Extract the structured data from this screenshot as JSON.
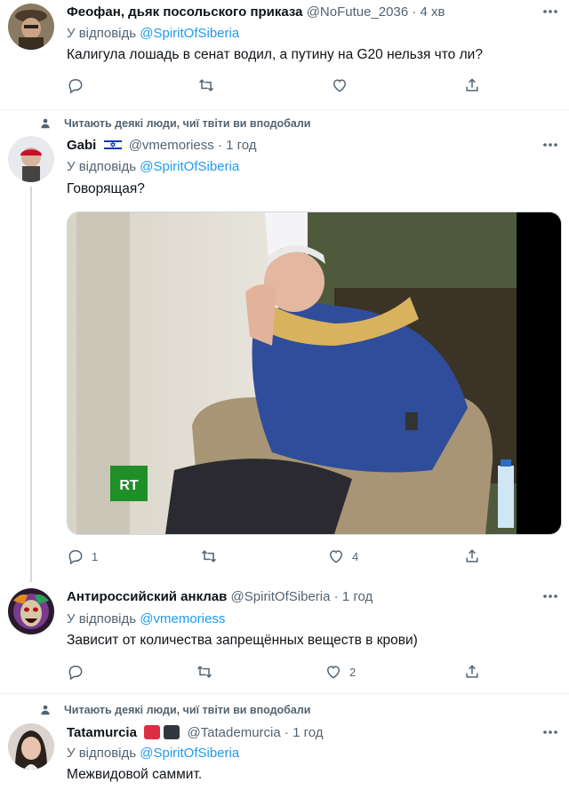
{
  "reply_prefix": "У відповідь",
  "tweets": [
    {
      "name": "Феофан, дьяк посольского приказа",
      "handle": "@NoFutue_2036",
      "time": "4 хв",
      "reply_to": "@SpiritOfSiberia",
      "text": "Калигула лошадь в сенат водил, а путину на G20 нельзя что ли?",
      "replies": "",
      "retweets": "",
      "likes": ""
    },
    {
      "social_context": "Читають деякі люди, чиї твіти ви вподобали",
      "name": "Gabi",
      "flag": "israel-flag",
      "handle": "@vmemoriess",
      "time": "1 год",
      "reply_to": "@SpiritOfSiberia",
      "text": "Говорящая?",
      "media_logo": "RT",
      "replies": "1",
      "retweets": "",
      "likes": "4"
    },
    {
      "name": "Антироссийский анклав",
      "handle": "@SpiritOfSiberia",
      "time": "1 год",
      "reply_to": "@vmemoriess",
      "text": "Зависит от количества запрещённых веществ в крови)",
      "replies": "",
      "retweets": "",
      "likes": "2"
    },
    {
      "social_context": "Читають деякі люди, чиї твіти ви вподобали",
      "name": "Tatamurcia",
      "handle": "@Tatademurcia",
      "time": "1 год",
      "reply_to": "@SpiritOfSiberia",
      "text": "Межвидовой саммит."
    }
  ],
  "colors": {
    "link": "#1d9bf0",
    "secondary": "#536471",
    "divider": "#eff3f4",
    "heart_square": "#e0245e"
  },
  "separator": "·"
}
